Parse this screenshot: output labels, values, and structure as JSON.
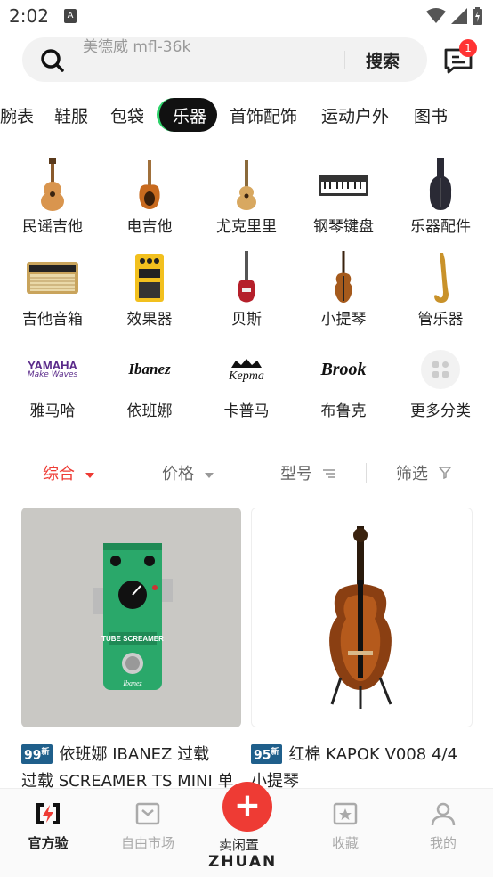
{
  "status": {
    "time": "2:02"
  },
  "search": {
    "placeholder": "美德威 mfl-36k",
    "button": "搜索",
    "badge_count": "1"
  },
  "tabs": [
    "腕表",
    "鞋服",
    "包袋",
    "乐器",
    "首饰配饰",
    "运动户外",
    "图书"
  ],
  "active_tab": "乐器",
  "accent_color": "#2ed36b",
  "categories": [
    {
      "label": "民谣吉他",
      "icon": "acoustic-guitar-icon"
    },
    {
      "label": "电吉他",
      "icon": "electric-guitar-icon"
    },
    {
      "label": "尤克里里",
      "icon": "ukulele-icon"
    },
    {
      "label": "钢琴键盘",
      "icon": "keyboard-icon"
    },
    {
      "label": "乐器配件",
      "icon": "gig-bag-icon"
    },
    {
      "label": "吉他音箱",
      "icon": "amplifier-icon"
    },
    {
      "label": "效果器",
      "icon": "effect-pedal-icon"
    },
    {
      "label": "贝斯",
      "icon": "bass-icon"
    },
    {
      "label": "小提琴",
      "icon": "violin-icon"
    },
    {
      "label": "管乐器",
      "icon": "saxophone-icon"
    },
    {
      "label": "雅马哈",
      "icon": "yamaha-logo"
    },
    {
      "label": "依班娜",
      "icon": "ibanez-logo"
    },
    {
      "label": "卡普马",
      "icon": "kepma-logo"
    },
    {
      "label": "布鲁克",
      "icon": "brook-logo"
    },
    {
      "label": "更多分类",
      "icon": "more-grid-icon"
    }
  ],
  "brand_logos": {
    "yamaha": "YAMAHA",
    "yamaha_sub": "Make Waves",
    "ibanez": "Ibanez",
    "kepma": "Kepma",
    "brook": "Brook"
  },
  "filters": {
    "sort": "综合",
    "price": "价格",
    "model": "型号",
    "filter": "筛选"
  },
  "sort_color": "#ee3b34",
  "products": [
    {
      "badge": "99",
      "badge_sup": "新",
      "title_line1": "依班娜 IBANEZ 过载",
      "title_line2": "过载 SCREAMER TS MINI 单",
      "pedal_text": "TUBE SCREAMER",
      "pedal_brand": "Ibanez"
    },
    {
      "badge": "95",
      "badge_sup": "新",
      "title_line1": "红棉 KAPOK V008 4/4",
      "title_line2": "小提琴"
    }
  ],
  "nav": {
    "official": "官方验",
    "market": "自由市场",
    "sell": "卖闲置",
    "fav": "收藏",
    "mine": "我的",
    "brand": "ZHUAN"
  }
}
